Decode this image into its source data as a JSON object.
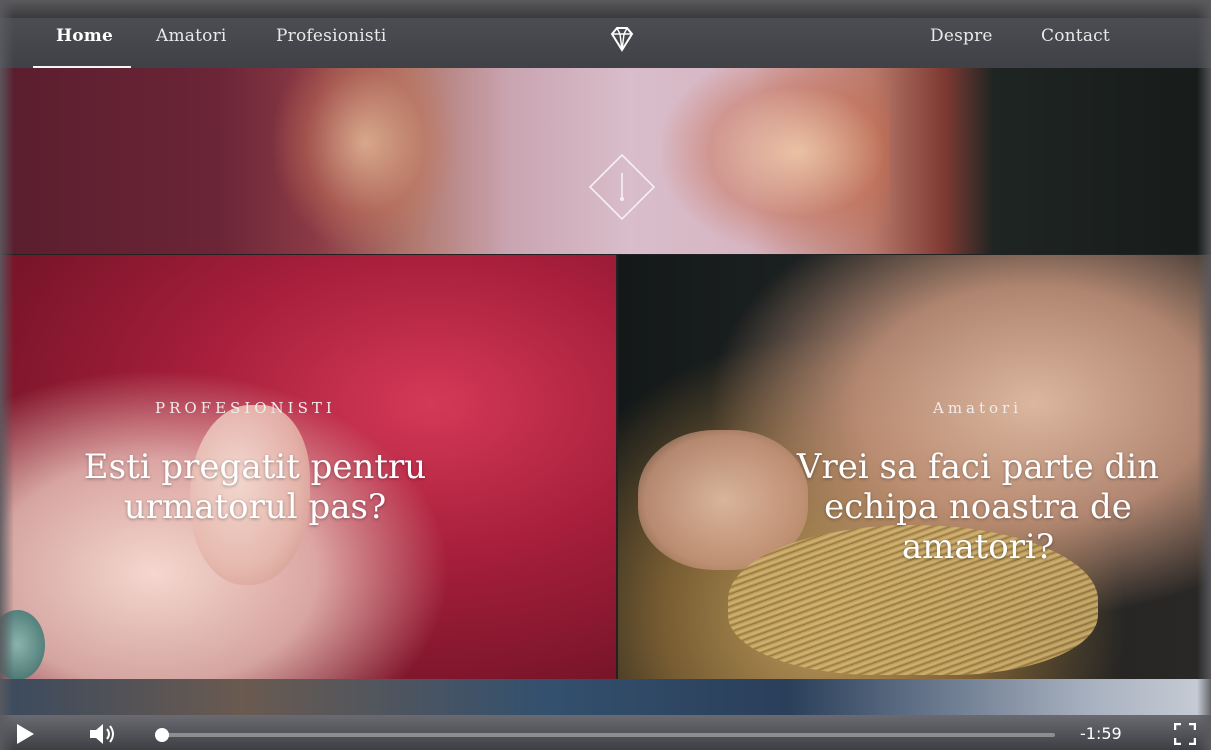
{
  "nav": {
    "items": [
      {
        "label": "Home",
        "active": true
      },
      {
        "label": "Amatori"
      },
      {
        "label": "Profesionisti"
      },
      {
        "label": "Despre"
      },
      {
        "label": "Contact"
      }
    ],
    "logo_icon": "diamond-icon"
  },
  "hero": {
    "icon": "diamond-down-arrow-icon"
  },
  "panels": {
    "left": {
      "label": "PROFESIONISTI",
      "heading": "Esti pregatit pentru urmatorul pas?"
    },
    "right": {
      "label": "Amatori",
      "heading": "Vrei sa faci parte din echipa noastra de amatori?"
    }
  },
  "video_controls": {
    "time_remaining": "-1:59",
    "progress_fraction": 0.0,
    "play_icon": "play-icon",
    "volume_icon": "volume-icon",
    "fullscreen_icon": "fullscreen-icon"
  },
  "colors": {
    "nav_bg": "#45474c",
    "accent_text": "#ffffff"
  }
}
